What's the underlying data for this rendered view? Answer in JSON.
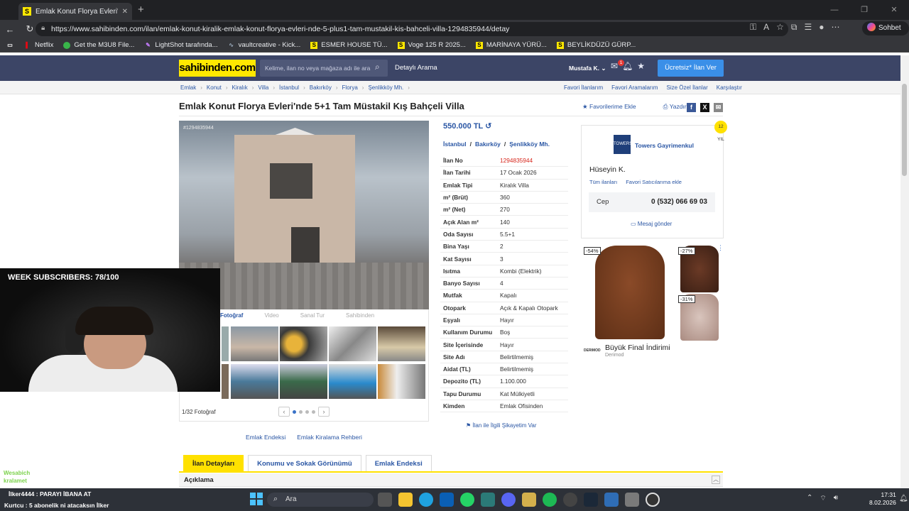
{
  "browser": {
    "tab_title": "Emlak Konut Florya Evleri'nde 5+1",
    "url": "https://www.sahibinden.com/ilan/emlak-konut-kiralik-emlak-konut-florya-evleri-nde-5-plus1-tam-mustakil-kis-bahceli-villa-1294835944/detay",
    "sohbet": "Sohbet et",
    "bookmarks": [
      "Netflix",
      "Get the M3U8 File...",
      "LightShot tarafında...",
      "vaultcreative - Kick...",
      "ESMER HOUSE TÜ...",
      "Voge 125 R 2025...",
      "MARİNAYA YÜRÜ...",
      "BEYLİKDÜZÜ GÜRP..."
    ]
  },
  "header": {
    "logo": "sahibinden.com",
    "search_placeholder": "Kelime, ilan no veya mağaza adı ile ara",
    "detailed_search": "Detaylı Arama",
    "user": "Mustafa K.",
    "notification_count": "1",
    "post_ad": "Ücretsiz* İlan Ver"
  },
  "breadcrumb": [
    "Emlak",
    "Konut",
    "Kiralık",
    "Villa",
    "İstanbul",
    "Bakırköy",
    "Florya",
    "Şenlikköy Mh."
  ],
  "breadcrumb_right": [
    "Favori İlanlarım",
    "Favori Aramalarım",
    "Size Özel İlanlar",
    "Karşılaştır"
  ],
  "listing": {
    "title": "Emlak Konut Florya Evleri'nde 5+1 Tam Müstakil Kış Bahçeli Villa",
    "add_favorite": "Favorilerime Ekle",
    "print": "Yazdır",
    "ad_no_overlay": "#1294835944",
    "photo_count": "1/32 Fotoğraf",
    "media_tabs": [
      "Fotoğraf",
      "Video",
      "Sanal Tur",
      "Sahibinden"
    ],
    "price": "550.000 TL",
    "location": [
      "İstanbul",
      "Bakırköy",
      "Şenlikköy Mh."
    ],
    "details": [
      {
        "k": "İlan No",
        "v": "1294835944"
      },
      {
        "k": "İlan Tarihi",
        "v": "17 Ocak 2026"
      },
      {
        "k": "Emlak Tipi",
        "v": "Kiralık Villa"
      },
      {
        "k": "m² (Brüt)",
        "v": "360"
      },
      {
        "k": "m² (Net)",
        "v": "270"
      },
      {
        "k": "Açık Alan m²",
        "v": "140"
      },
      {
        "k": "Oda Sayısı",
        "v": "5.5+1"
      },
      {
        "k": "Bina Yaşı",
        "v": "2"
      },
      {
        "k": "Kat Sayısı",
        "v": "3"
      },
      {
        "k": "Isıtma",
        "v": "Kombi (Elektrik)"
      },
      {
        "k": "Banyo Sayısı",
        "v": "4"
      },
      {
        "k": "Mutfak",
        "v": "Kapalı"
      },
      {
        "k": "Otopark",
        "v": "Açık & Kapalı Otopark"
      },
      {
        "k": "Eşyalı",
        "v": "Hayır"
      },
      {
        "k": "Kullanım Durumu",
        "v": "Boş"
      },
      {
        "k": "Site İçerisinde",
        "v": "Hayır"
      },
      {
        "k": "Site Adı",
        "v": "Belirtilmemiş"
      },
      {
        "k": "Aidat (TL)",
        "v": "Belirtilmemiş"
      },
      {
        "k": "Depozito (TL)",
        "v": "1.100.000"
      },
      {
        "k": "Tapu Durumu",
        "v": "Kat Mülkiyetli"
      },
      {
        "k": "Kimden",
        "v": "Emlak Ofisinden"
      }
    ],
    "complain": "İlan ile İlgili Şikayetim Var",
    "links": [
      "Emlak Endeksi",
      "Emlak Kiralama Rehberi"
    ]
  },
  "seller": {
    "agency": "Towers Gayrimenkul",
    "badge": "12 YIL",
    "name": "Hüseyin K.",
    "all_ads": "Tüm ilanları",
    "fav_seller": "Favori Satıcılarıma ekle",
    "cep_label": "Cep",
    "phone": "0 (532) 066 69 03",
    "message": "Mesaj gönder"
  },
  "ad": {
    "disc1": "-54%",
    "disc2": "-27%",
    "disc3": "-31%",
    "text": "Büyük Final İndirimi",
    "brand": "Derimod",
    "brand_logo": "DERIMOD"
  },
  "tabs": [
    "İlan Detayları",
    "Konumu ve Sokak Görünümü",
    "Emlak Endeksi"
  ],
  "description_title": "Açıklama",
  "stream": {
    "subs": "WEEK SUBSCRIBERS: 78/100",
    "chat": [
      {
        "u": "Wesabich",
        "m": ": çikolata da ataşte boş gelmesin"
      },
      {
        "u": "kralamet",
        "m": ": vusha aman"
      }
    ],
    "alert1": "İlker4444 : PARAYI İBANA AT",
    "alert2": "Kurtcu : 5 abonelik ni atacaksın İlker"
  },
  "taskbar": {
    "search": "Ara",
    "time": "17:31",
    "date": "8.02.2026"
  },
  "colors": {
    "brand_yellow": "#ffe800",
    "header_navy": "#3c4566",
    "link_blue": "#2a56a4"
  }
}
